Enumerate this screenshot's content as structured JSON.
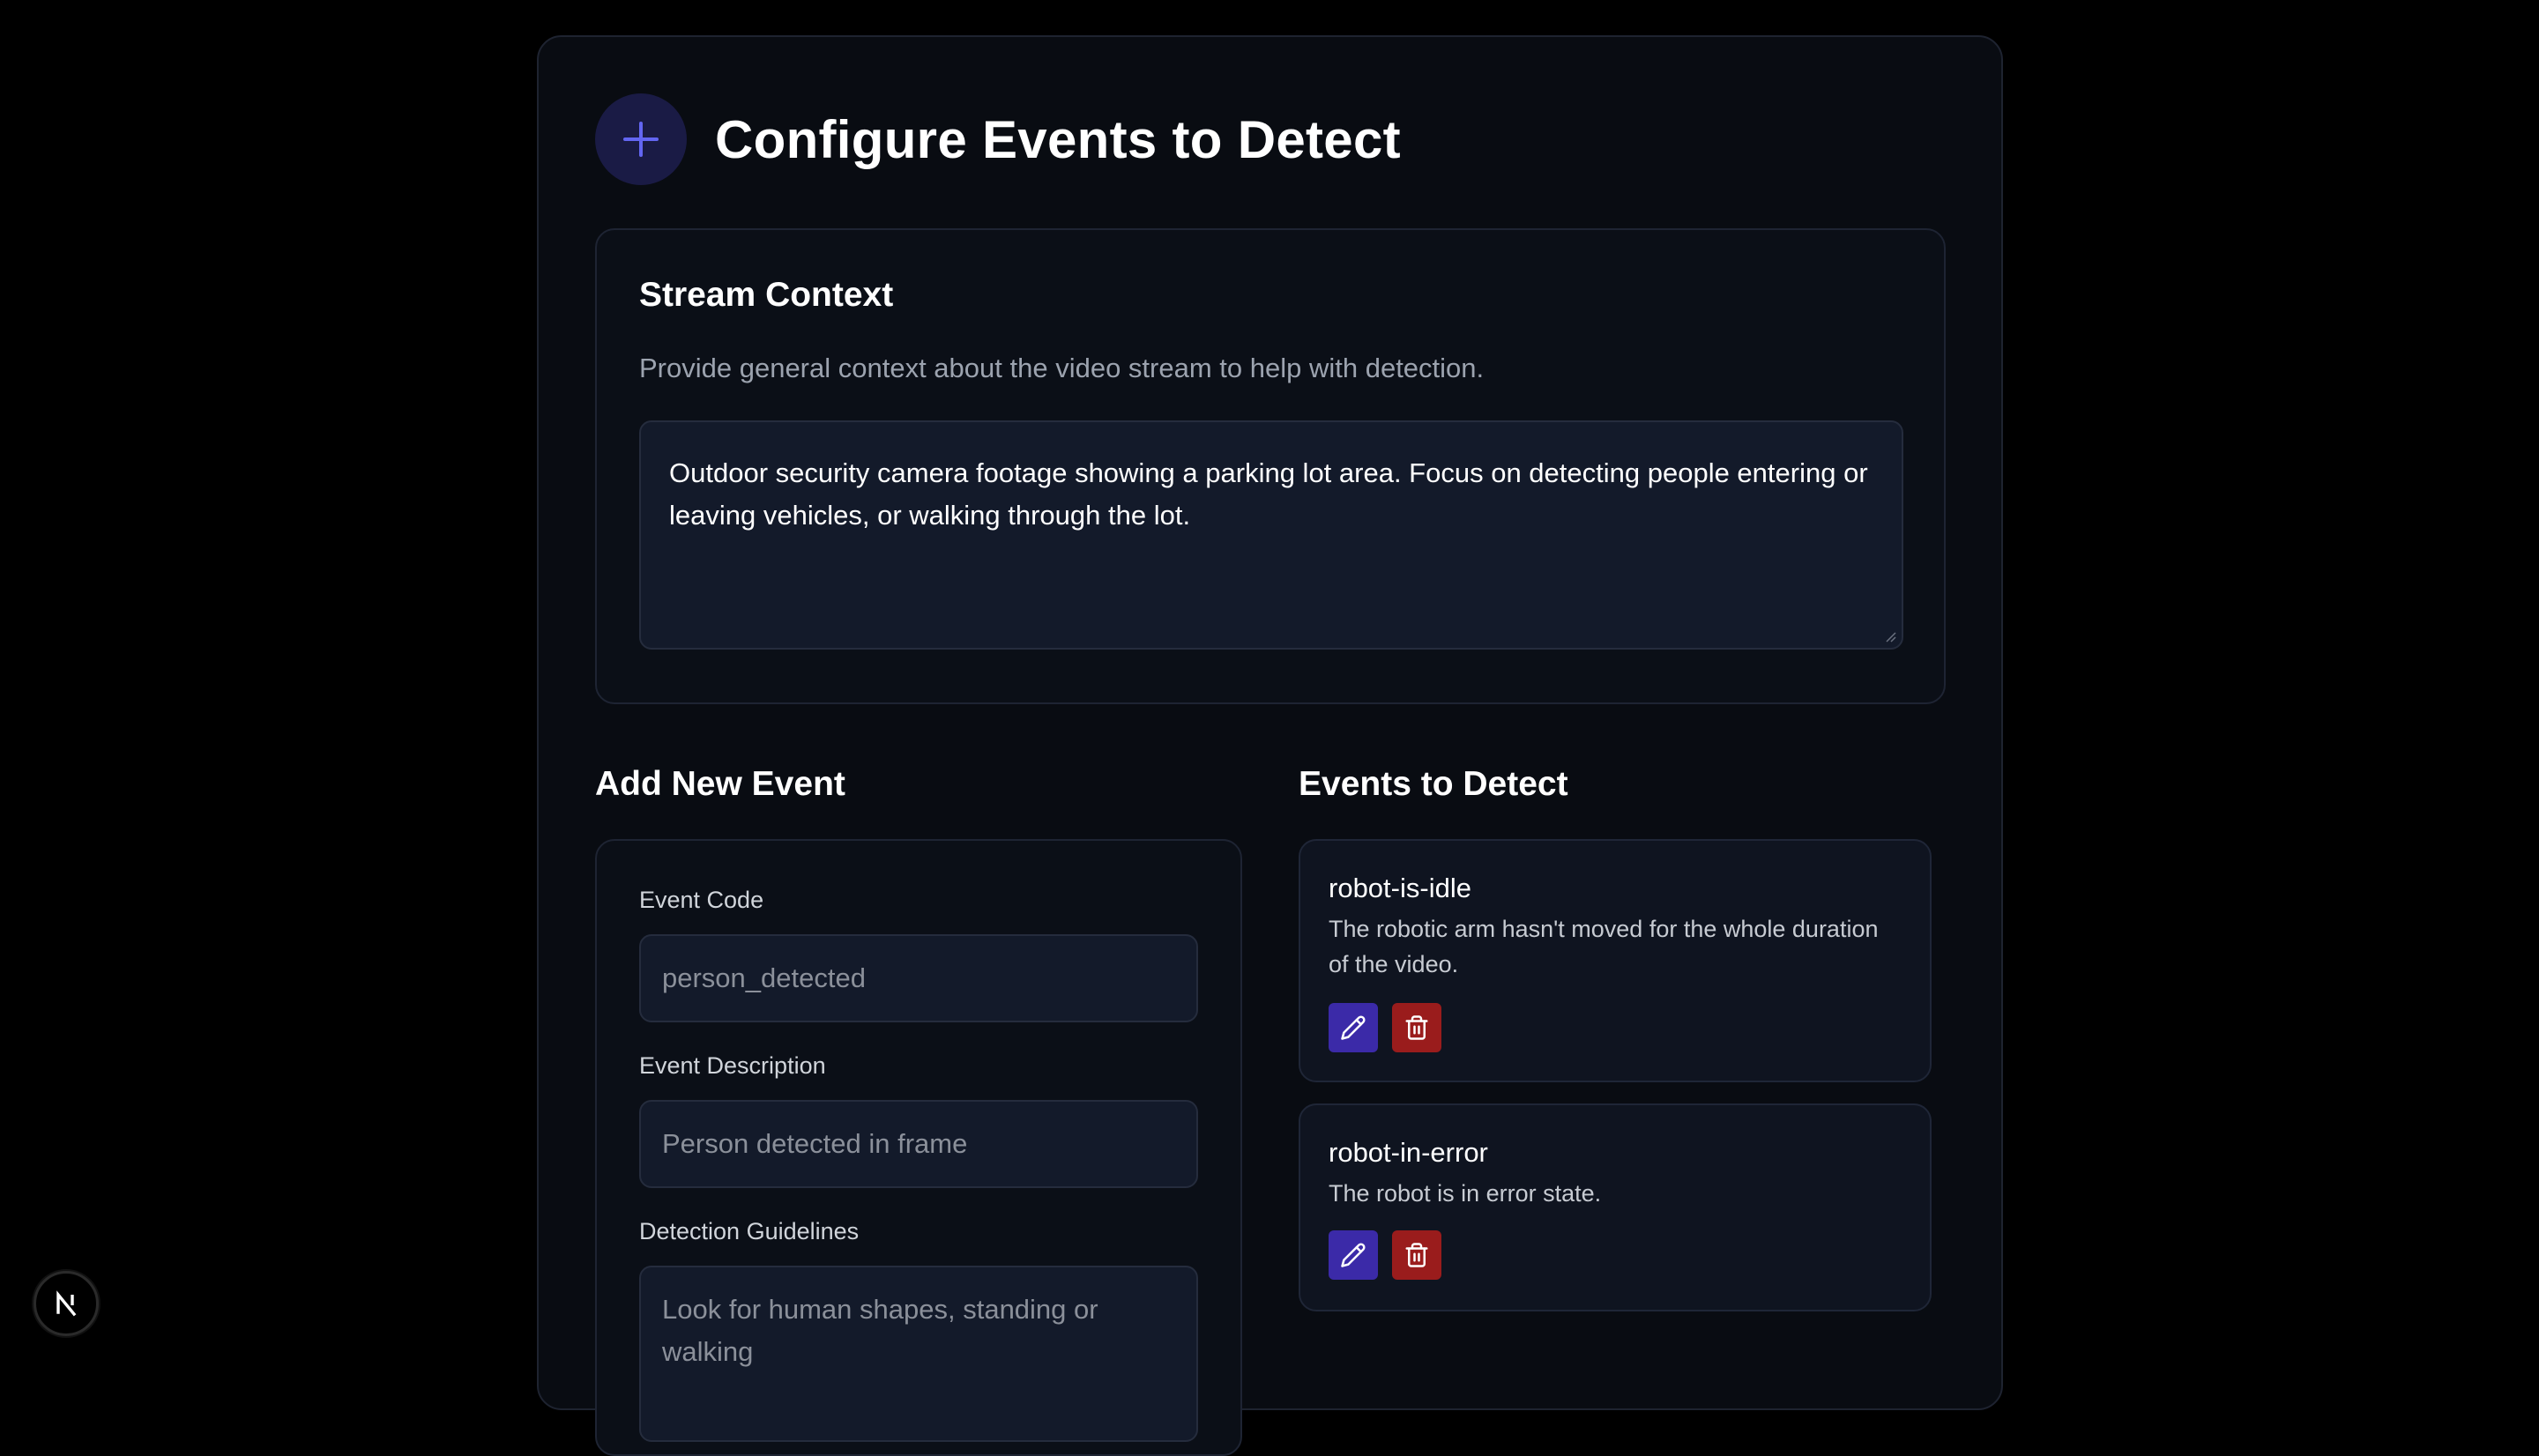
{
  "header": {
    "title": "Configure Events to Detect",
    "icon": "plus-icon"
  },
  "context": {
    "title": "Stream Context",
    "description": "Provide general context about the video stream to help with detection.",
    "value": "Outdoor security camera footage showing a parking lot area. Focus on detecting people entering or leaving vehicles, or walking through the lot."
  },
  "add_event": {
    "heading": "Add New Event",
    "code_label": "Event Code",
    "code_placeholder": "person_detected",
    "description_label": "Event Description",
    "description_placeholder": "Person detected in frame",
    "guidelines_label": "Detection Guidelines",
    "guidelines_placeholder": "Look for human shapes, standing or walking"
  },
  "events": {
    "heading": "Events to Detect",
    "items": [
      {
        "code": "robot-is-idle",
        "description": "The robotic arm hasn't moved for the whole duration of the video."
      },
      {
        "code": "robot-in-error",
        "description": "The robot is in error state."
      }
    ]
  },
  "badge": {
    "label": "N"
  },
  "colors": {
    "background": "#000000",
    "panel": "#090c12",
    "accent": "#3b2aa8",
    "danger": "#9a1c1c",
    "plus_icon": "#6366f1"
  }
}
